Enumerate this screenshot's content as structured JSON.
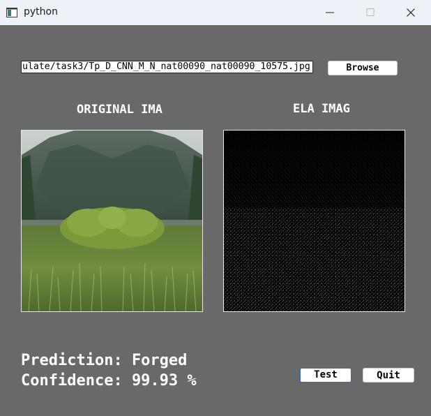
{
  "window": {
    "title": "python",
    "app_icon": "python-window-icon",
    "background_color": "#696969"
  },
  "titlebar_controls": {
    "minimize_icon": "minimize-icon",
    "maximize_icon": "maximize-icon",
    "close_icon": "close-icon"
  },
  "file_input": {
    "value": "ulate/task3/Tp_D_CNN_M_N_nat00090_nat00090_10575.jpg"
  },
  "buttons": {
    "browse_label": "Browse",
    "test_label": "Test",
    "quit_label": "Quit"
  },
  "images": {
    "original_label": "ORIGINAL IMA",
    "ela_label": "ELA IMAG"
  },
  "result": {
    "prediction_text": "Prediction: Forged",
    "confidence_text": "Confidence: 99.93 %"
  },
  "colors": {
    "accent_focus_border": "#2a6fd6",
    "titlebar": "#eef2f8"
  }
}
